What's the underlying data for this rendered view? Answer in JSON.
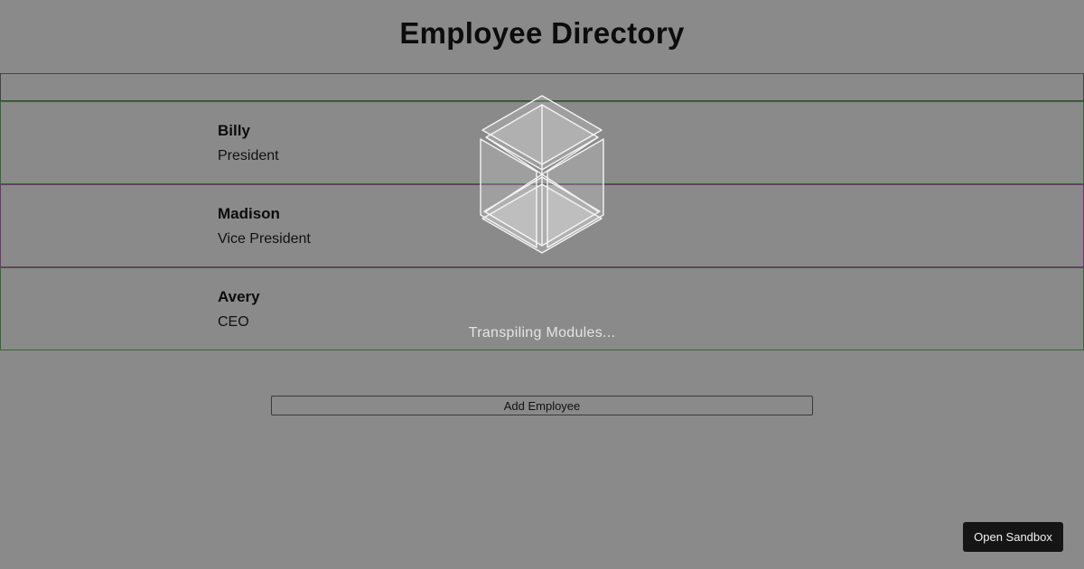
{
  "header": {
    "title": "Employee Directory"
  },
  "search": {
    "value": "",
    "placeholder": ""
  },
  "employees": [
    {
      "name": "Billy",
      "role": "President"
    },
    {
      "name": "Madison",
      "role": "Vice President"
    },
    {
      "name": "Avery",
      "role": "CEO"
    }
  ],
  "actions": {
    "add_label": "Add Employee"
  },
  "loader": {
    "text": "Transpiling Modules...",
    "icon": "sandbox-cube-icon"
  },
  "footer": {
    "open_sandbox_label": "Open Sandbox"
  },
  "colors": {
    "background": "#8a8a8a",
    "row_border_green": "#2f6b2f",
    "row_border_purple": "#7a2f7a",
    "dark_button": "#151515"
  }
}
